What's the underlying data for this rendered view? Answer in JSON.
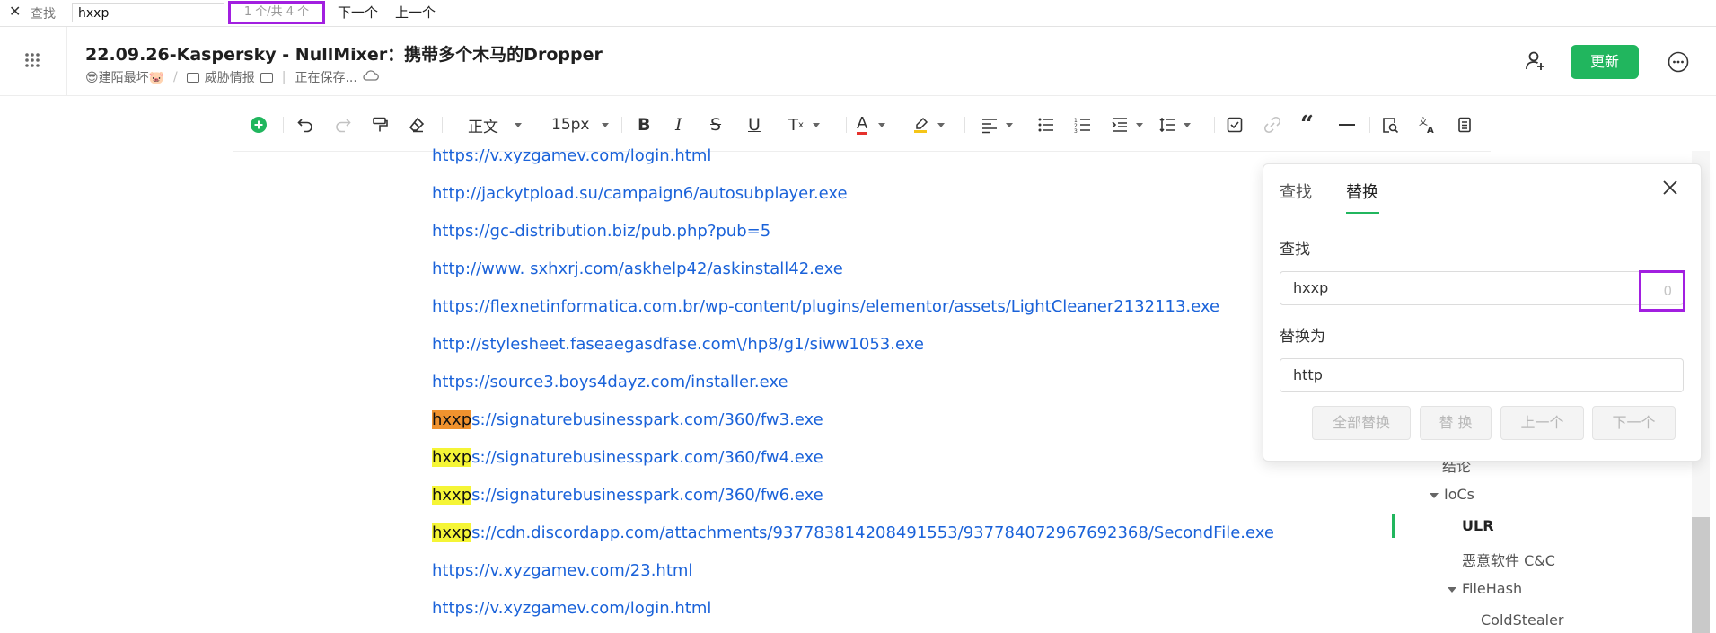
{
  "findbar": {
    "label": "查找",
    "query": "hxxp",
    "match_count": "1 个/共 4 个",
    "next_label": "下一个",
    "prev_label": "上一个"
  },
  "header": {
    "title": "22.09.26-Kaspersky - NullMixer：携带多个木马的Dropper",
    "author": "😎建陌最坏🐷",
    "knowledge_base": "威胁情报",
    "save_status": "正在保存...",
    "update_label": "更新"
  },
  "toolbar": {
    "paragraph_style": "正文",
    "font_size": "15px"
  },
  "content": {
    "lines": [
      {
        "prefix": "",
        "text": "https://v.xyzgamev.com/login.html"
      },
      {
        "prefix": "",
        "text": "http://jackytpload.su/campaign6/autosubplayer.exe"
      },
      {
        "prefix": "",
        "text": "https://gc-distribution.biz/pub.php?pub=5"
      },
      {
        "prefix": "",
        "text": "http://www. sxhxrj.com/askhelp42/askinstall42.exe"
      },
      {
        "prefix": "",
        "text": "https://flexnetinformatica.com.br/wp-content/plugins/elementor/assets/LightCleaner2132113.exe"
      },
      {
        "prefix": "",
        "text": "http://stylesheet.faseaegasdfase.com\\/hp8/g1/siww1053.exe"
      },
      {
        "prefix": "",
        "text": "https://source3.boys4dayz.com/installer.exe"
      },
      {
        "prefix": "hxxp",
        "text": "s://signaturebusinesspark.com/360/fw3.exe",
        "current": true
      },
      {
        "prefix": "hxxp",
        "text": "s://signaturebusinesspark.com/360/fw4.exe"
      },
      {
        "prefix": "hxxp",
        "text": "s://signaturebusinesspark.com/360/fw6.exe"
      },
      {
        "prefix": "hxxp",
        "text": "s://cdn.discordapp.com/attachments/937783814208491553/937784072967692368/SecondFile.exe"
      },
      {
        "prefix": "",
        "text": "https://v.xyzgamev.com/23.html"
      },
      {
        "prefix": "",
        "text": "https://v.xyzgamev.com/login.html"
      }
    ]
  },
  "outline": {
    "items": [
      {
        "label": "结论"
      },
      {
        "label": "IoCs"
      },
      {
        "label": "ULR"
      },
      {
        "label": "恶意软件 C&C"
      },
      {
        "label": "FileHash"
      },
      {
        "label": "ColdStealer"
      }
    ]
  },
  "replace_panel": {
    "tab_find": "查找",
    "tab_replace": "替换",
    "find_label": "查找",
    "find_value": "hxxp",
    "match_count": "0",
    "replace_label": "替换为",
    "replace_value": "http",
    "btn_replace_all": "全部替换",
    "btn_replace": "替 换",
    "btn_prev": "上一个",
    "btn_next": "下一个"
  },
  "colors": {
    "accent": "#21b65e",
    "link": "#1a62d9",
    "highlight": "#f5f536",
    "highlight_current": "#f0922e",
    "annotation": "#a21fe0"
  }
}
